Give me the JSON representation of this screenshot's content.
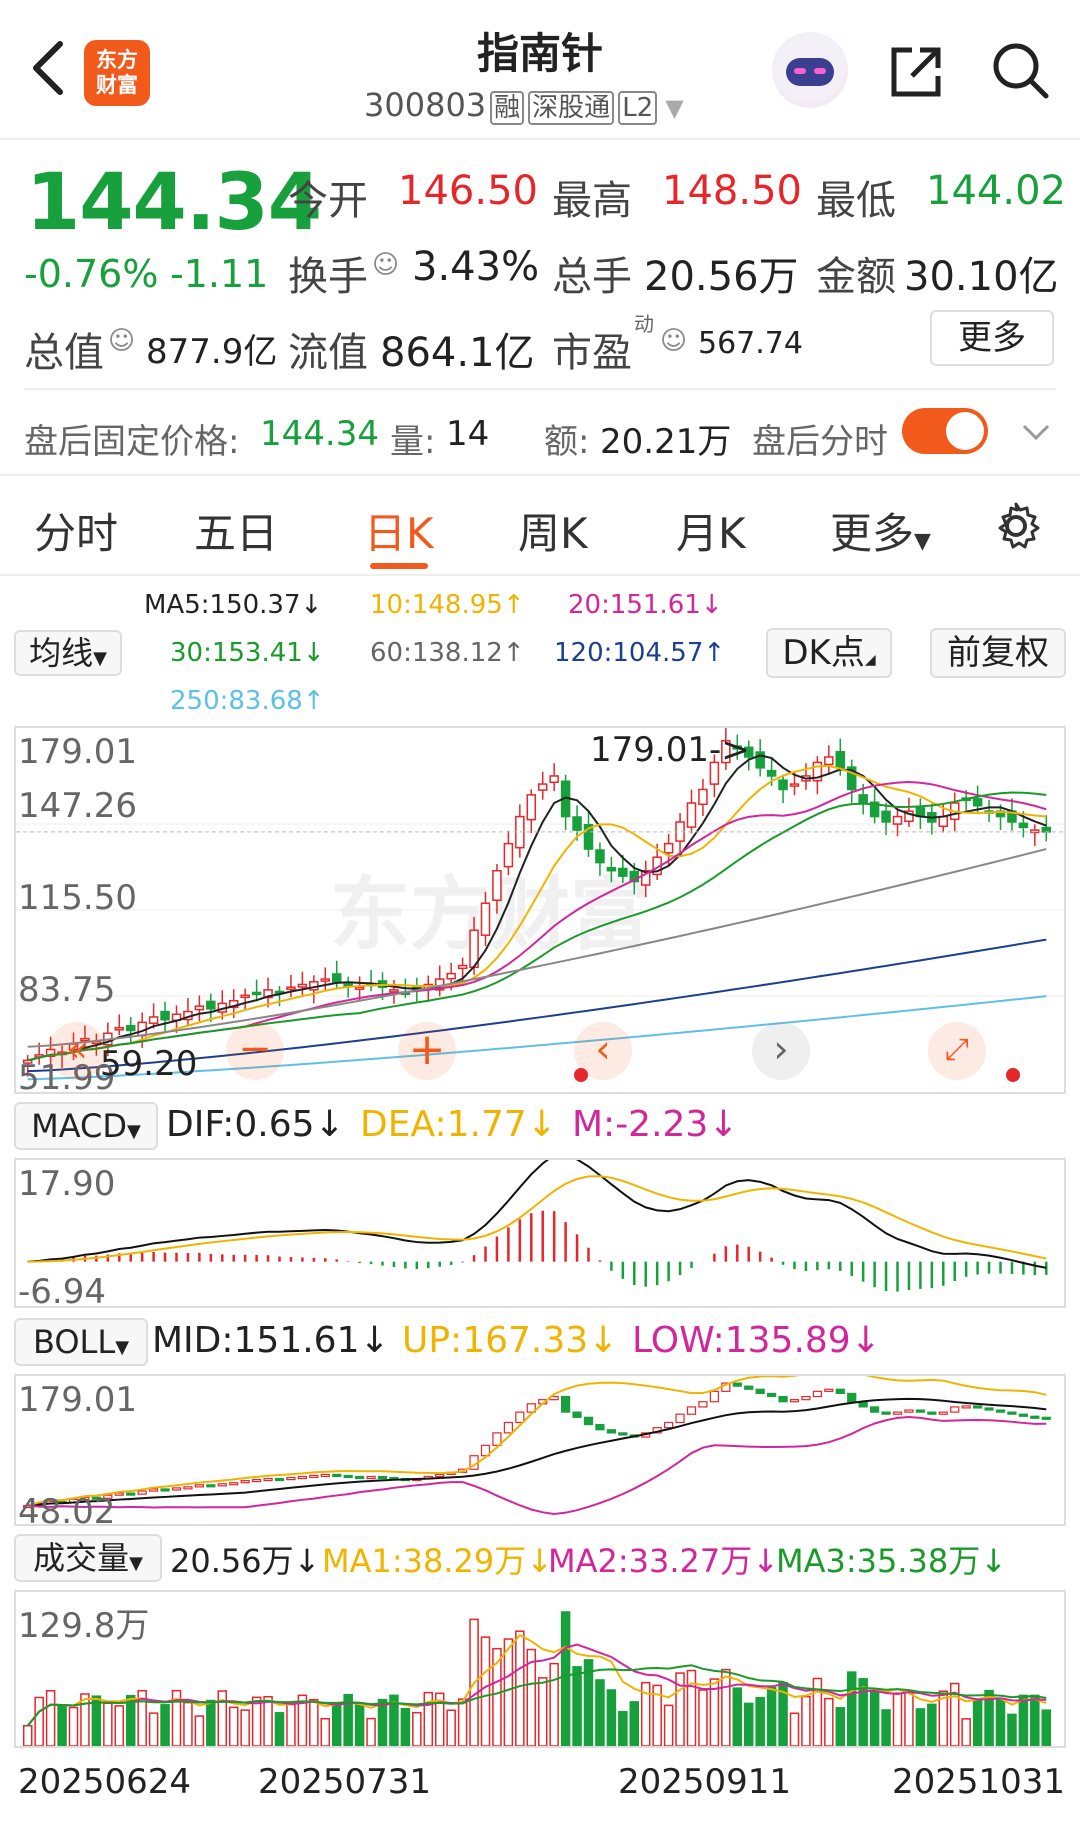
{
  "header": {
    "title": "指南针",
    "code": "300803",
    "tags": [
      "融",
      "深股通",
      "L2"
    ]
  },
  "logo": {
    "line1": "东方",
    "line2": "财富"
  },
  "quote": {
    "price": "144.34",
    "change_pct": "-0.76%",
    "change": "-1.11",
    "open_label": "今开",
    "open": "146.50",
    "high_label": "最高",
    "high": "148.50",
    "low_label": "最低",
    "low": "144.02",
    "turnover_label": "换手",
    "turnover": "3.43%",
    "volume_label": "总手",
    "volume": "20.56万",
    "amount_label": "金额",
    "amount": "30.10亿",
    "mcap_label": "总值",
    "mcap": "877.9亿",
    "float_label": "流值",
    "float": "864.1亿",
    "pe_label": "市盈",
    "pe_sup": "动",
    "pe": "567.74",
    "more": "更多"
  },
  "after_hours": {
    "label": "盘后固定价格:",
    "price": "144.34",
    "vol_label": "量:",
    "vol": "14",
    "amt_label": "额:",
    "amt": "20.21万",
    "switch_label": "盘后分时",
    "switch_on": true
  },
  "tabs": [
    "分时",
    "五日",
    "日K",
    "周K",
    "月K",
    "更多"
  ],
  "active_tab": 2,
  "ma": {
    "button": "均线",
    "ma5": "MA5:150.37",
    "ma10": "10:148.95",
    "ma20": "20:151.61",
    "ma30": "30:153.41",
    "ma60": "60:138.12",
    "ma120": "120:104.57",
    "ma250": "250:83.68",
    "dk": "DK点",
    "fq": "前复权"
  },
  "kline": {
    "y_labels": [
      "179.01",
      "147.26",
      "115.50",
      "83.75",
      "51.99"
    ],
    "max_annot": "179.01->",
    "min_annot": "59.20",
    "watermark": "东方财富"
  },
  "macd": {
    "button": "MACD",
    "dif": "DIF:0.65",
    "dea": "DEA:1.77",
    "m": "M:-2.23",
    "y_top": "17.90",
    "y_bottom": "-6.94"
  },
  "boll": {
    "button": "BOLL",
    "mid": "MID:151.61",
    "up": "UP:167.33",
    "low": "LOW:135.89",
    "y_top": "179.01",
    "y_bottom": "48.02"
  },
  "vol": {
    "button": "成交量",
    "cur": "20.56万",
    "ma1": "MA1:38.29万",
    "ma2": "MA2:33.27万",
    "ma3": "MA3:35.38万",
    "y_top": "129.8万"
  },
  "x_labels": [
    "20250624",
    "20250731",
    "20250911",
    "20251031"
  ],
  "colors": {
    "up": "#e5262a",
    "down": "#17a03c",
    "accent": "#f25a1c",
    "ma5": "#222222",
    "ma10": "#f0b400",
    "ma20": "#d2269a",
    "ma30": "#1a9a2a",
    "ma60": "#888888",
    "ma120": "#1d3f8f",
    "ma250": "#5fc0e6"
  },
  "chart_data": [
    {
      "type": "candlestick",
      "name": "日K",
      "y_range": [
        51.99,
        179.01
      ],
      "closes": [
        60,
        62,
        64,
        63,
        66,
        68,
        67,
        70,
        72,
        71,
        74,
        76,
        75,
        77,
        78,
        80,
        79,
        81,
        82,
        84,
        85,
        86,
        85,
        87,
        88,
        89,
        90,
        89,
        88,
        87,
        88,
        87,
        86,
        85,
        86,
        88,
        90,
        92,
        95,
        108,
        118,
        130,
        140,
        150,
        158,
        162,
        165,
        150,
        145,
        138,
        133,
        130,
        128,
        126,
        130,
        135,
        140,
        148,
        155,
        160,
        170,
        178,
        175,
        172,
        168,
        165,
        160,
        162,
        165,
        170,
        172,
        168,
        160,
        155,
        150,
        148,
        150,
        152,
        150,
        148,
        150,
        155,
        156,
        154,
        152,
        150,
        148,
        146,
        145,
        144.34
      ],
      "max": 179.01,
      "min": 59.2
    },
    {
      "type": "line",
      "name": "MACD",
      "y_range": [
        -6.94,
        17.9
      ],
      "dif": 0.65,
      "dea": 1.77,
      "m": -2.23
    },
    {
      "type": "line",
      "name": "BOLL",
      "y_range": [
        48.02,
        179.01
      ],
      "mid": 151.61,
      "up": 167.33,
      "low": 135.89
    },
    {
      "type": "bar",
      "name": "成交量",
      "y_max": "129.8万",
      "cur": "20.56万"
    }
  ]
}
